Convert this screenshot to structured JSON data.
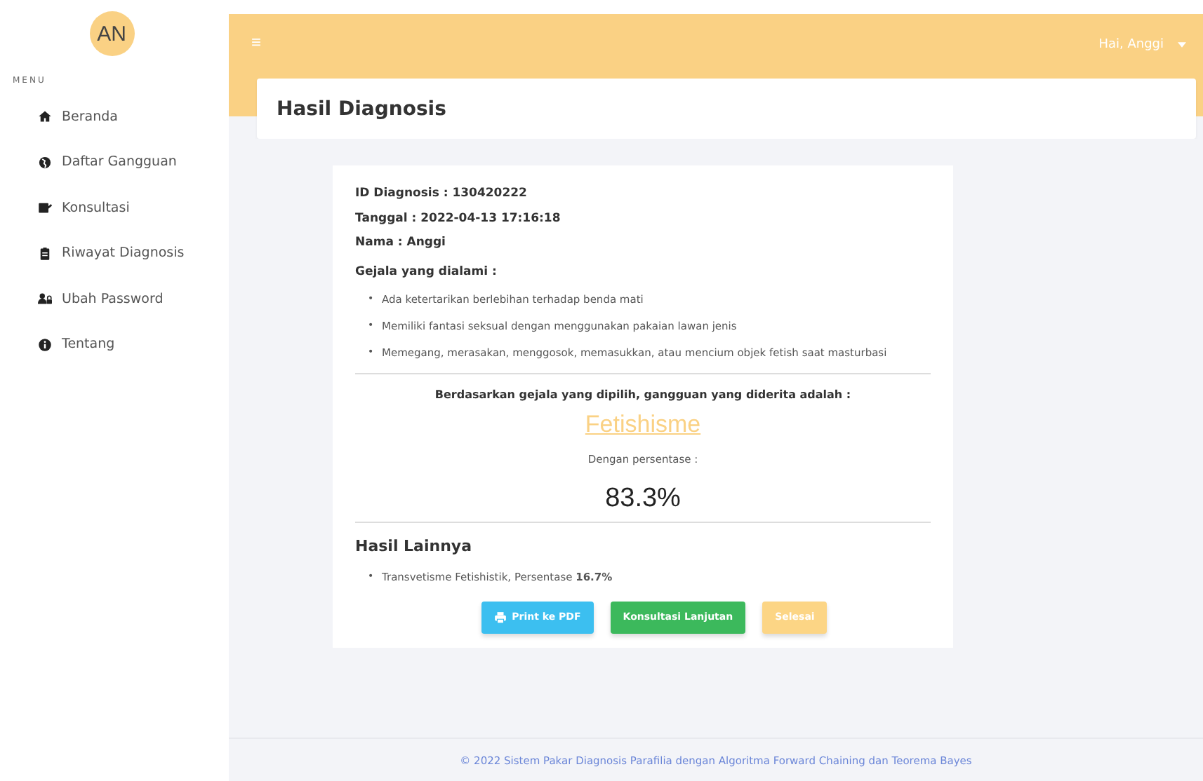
{
  "sidebar": {
    "avatar": "AN",
    "menu_label": "MENU",
    "items": [
      {
        "label": "Beranda",
        "selected": false
      },
      {
        "label": "Daftar Gangguan",
        "selected": false
      },
      {
        "label": "Konsultasi",
        "selected": false
      },
      {
        "label": "Riwayat Diagnosis",
        "selected": false
      },
      {
        "label": "Ubah Password",
        "selected": false
      },
      {
        "label": "Tentang",
        "selected": false
      }
    ]
  },
  "topbar": {
    "menu_glyph": "≡",
    "user": "Hai, Anggi"
  },
  "page_title": "Hasil Diagnosis",
  "result": {
    "info": [
      "ID Diagnosis : 130420222",
      "Tanggal : 2022-04-13 17:16:18",
      "Nama : Anggi"
    ],
    "symptoms_title": "Gejala yang dialami :",
    "symptoms": [
      {
        "bullet": "•",
        "text": "Ada ketertarikan berlebihan terhadap benda mati"
      },
      {
        "bullet": "•",
        "text": "Memiliki fantasi seksual dengan menggunakan pakaian lawan jenis"
      },
      {
        "bullet": "•",
        "text": "Memegang, merasakan, menggosok, memasukkan, atau mencium objek fetish saat masturbasi"
      }
    ],
    "conclusion": "Berdasarkan gejala yang dipilih, gangguan yang diderita adalah :",
    "disorder": "Fetishisme",
    "percent_label": "Dengan persentase :",
    "percent": "83.3%",
    "others_title": "Hasil Lainnya",
    "others": [
      {
        "bullet": "•",
        "text": "Transvetisme Fetishistik, Persentase **16.7%**"
      }
    ],
    "buttons": [
      {
        "kind": "print",
        "label": "Print ke PDF"
      },
      {
        "kind": "consult",
        "label": "Konsultasi Lanjutan"
      },
      {
        "kind": "done",
        "label": "Selesai"
      }
    ]
  },
  "footer": "© 2022 Sistem Pakar Diagnosis Parafilia dengan Algoritma Forward Chaining dan Teorema Bayes"
}
